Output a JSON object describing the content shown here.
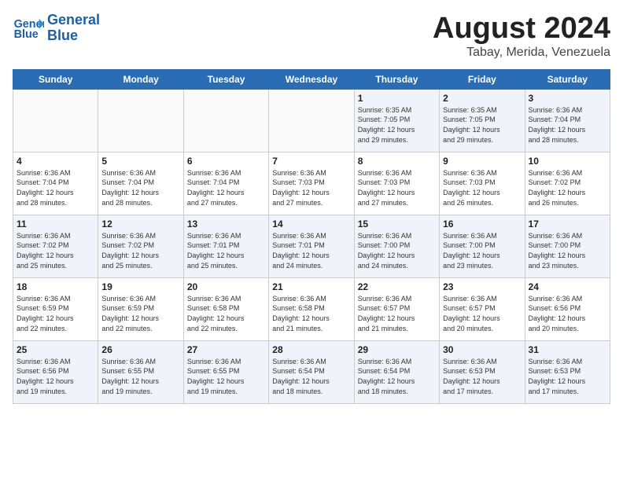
{
  "header": {
    "logo_line1": "General",
    "logo_line2": "Blue",
    "month": "August 2024",
    "location": "Tabay, Merida, Venezuela"
  },
  "weekdays": [
    "Sunday",
    "Monday",
    "Tuesday",
    "Wednesday",
    "Thursday",
    "Friday",
    "Saturday"
  ],
  "weeks": [
    [
      {
        "day": "",
        "info": ""
      },
      {
        "day": "",
        "info": ""
      },
      {
        "day": "",
        "info": ""
      },
      {
        "day": "",
        "info": ""
      },
      {
        "day": "1",
        "info": "Sunrise: 6:35 AM\nSunset: 7:05 PM\nDaylight: 12 hours\nand 29 minutes."
      },
      {
        "day": "2",
        "info": "Sunrise: 6:35 AM\nSunset: 7:05 PM\nDaylight: 12 hours\nand 29 minutes."
      },
      {
        "day": "3",
        "info": "Sunrise: 6:36 AM\nSunset: 7:04 PM\nDaylight: 12 hours\nand 28 minutes."
      }
    ],
    [
      {
        "day": "4",
        "info": "Sunrise: 6:36 AM\nSunset: 7:04 PM\nDaylight: 12 hours\nand 28 minutes."
      },
      {
        "day": "5",
        "info": "Sunrise: 6:36 AM\nSunset: 7:04 PM\nDaylight: 12 hours\nand 28 minutes."
      },
      {
        "day": "6",
        "info": "Sunrise: 6:36 AM\nSunset: 7:04 PM\nDaylight: 12 hours\nand 27 minutes."
      },
      {
        "day": "7",
        "info": "Sunrise: 6:36 AM\nSunset: 7:03 PM\nDaylight: 12 hours\nand 27 minutes."
      },
      {
        "day": "8",
        "info": "Sunrise: 6:36 AM\nSunset: 7:03 PM\nDaylight: 12 hours\nand 27 minutes."
      },
      {
        "day": "9",
        "info": "Sunrise: 6:36 AM\nSunset: 7:03 PM\nDaylight: 12 hours\nand 26 minutes."
      },
      {
        "day": "10",
        "info": "Sunrise: 6:36 AM\nSunset: 7:02 PM\nDaylight: 12 hours\nand 26 minutes."
      }
    ],
    [
      {
        "day": "11",
        "info": "Sunrise: 6:36 AM\nSunset: 7:02 PM\nDaylight: 12 hours\nand 25 minutes."
      },
      {
        "day": "12",
        "info": "Sunrise: 6:36 AM\nSunset: 7:02 PM\nDaylight: 12 hours\nand 25 minutes."
      },
      {
        "day": "13",
        "info": "Sunrise: 6:36 AM\nSunset: 7:01 PM\nDaylight: 12 hours\nand 25 minutes."
      },
      {
        "day": "14",
        "info": "Sunrise: 6:36 AM\nSunset: 7:01 PM\nDaylight: 12 hours\nand 24 minutes."
      },
      {
        "day": "15",
        "info": "Sunrise: 6:36 AM\nSunset: 7:00 PM\nDaylight: 12 hours\nand 24 minutes."
      },
      {
        "day": "16",
        "info": "Sunrise: 6:36 AM\nSunset: 7:00 PM\nDaylight: 12 hours\nand 23 minutes."
      },
      {
        "day": "17",
        "info": "Sunrise: 6:36 AM\nSunset: 7:00 PM\nDaylight: 12 hours\nand 23 minutes."
      }
    ],
    [
      {
        "day": "18",
        "info": "Sunrise: 6:36 AM\nSunset: 6:59 PM\nDaylight: 12 hours\nand 22 minutes."
      },
      {
        "day": "19",
        "info": "Sunrise: 6:36 AM\nSunset: 6:59 PM\nDaylight: 12 hours\nand 22 minutes."
      },
      {
        "day": "20",
        "info": "Sunrise: 6:36 AM\nSunset: 6:58 PM\nDaylight: 12 hours\nand 22 minutes."
      },
      {
        "day": "21",
        "info": "Sunrise: 6:36 AM\nSunset: 6:58 PM\nDaylight: 12 hours\nand 21 minutes."
      },
      {
        "day": "22",
        "info": "Sunrise: 6:36 AM\nSunset: 6:57 PM\nDaylight: 12 hours\nand 21 minutes."
      },
      {
        "day": "23",
        "info": "Sunrise: 6:36 AM\nSunset: 6:57 PM\nDaylight: 12 hours\nand 20 minutes."
      },
      {
        "day": "24",
        "info": "Sunrise: 6:36 AM\nSunset: 6:56 PM\nDaylight: 12 hours\nand 20 minutes."
      }
    ],
    [
      {
        "day": "25",
        "info": "Sunrise: 6:36 AM\nSunset: 6:56 PM\nDaylight: 12 hours\nand 19 minutes."
      },
      {
        "day": "26",
        "info": "Sunrise: 6:36 AM\nSunset: 6:55 PM\nDaylight: 12 hours\nand 19 minutes."
      },
      {
        "day": "27",
        "info": "Sunrise: 6:36 AM\nSunset: 6:55 PM\nDaylight: 12 hours\nand 19 minutes."
      },
      {
        "day": "28",
        "info": "Sunrise: 6:36 AM\nSunset: 6:54 PM\nDaylight: 12 hours\nand 18 minutes."
      },
      {
        "day": "29",
        "info": "Sunrise: 6:36 AM\nSunset: 6:54 PM\nDaylight: 12 hours\nand 18 minutes."
      },
      {
        "day": "30",
        "info": "Sunrise: 6:36 AM\nSunset: 6:53 PM\nDaylight: 12 hours\nand 17 minutes."
      },
      {
        "day": "31",
        "info": "Sunrise: 6:36 AM\nSunset: 6:53 PM\nDaylight: 12 hours\nand 17 minutes."
      }
    ]
  ]
}
